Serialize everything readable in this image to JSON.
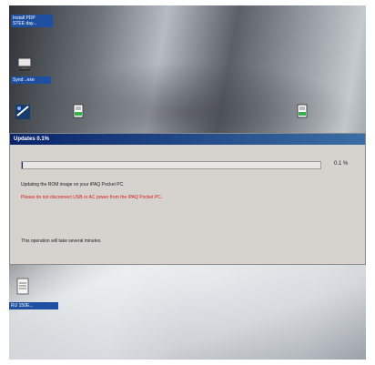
{
  "desktop": {
    "top_left_label": "Install PDP\nSTEE day...",
    "icon2_label": "Synd ..exe",
    "bottom_left_label": "RU 150E..."
  },
  "dialog": {
    "title": "Updates 0.1%",
    "progress": {
      "percent_text": "0.1 %",
      "fraction": 0.001
    },
    "message": "Updating the ROM image on your iPAQ Pocket PC.",
    "warning": "Please do not disconnect USB or AC power from the iPAQ Pocket PC.",
    "note": "This operation will take several minutes."
  },
  "colors": {
    "title_bar": "#0a246a",
    "warning_text": "#d41a1a",
    "dialog_bg": "#d6d3ce"
  }
}
